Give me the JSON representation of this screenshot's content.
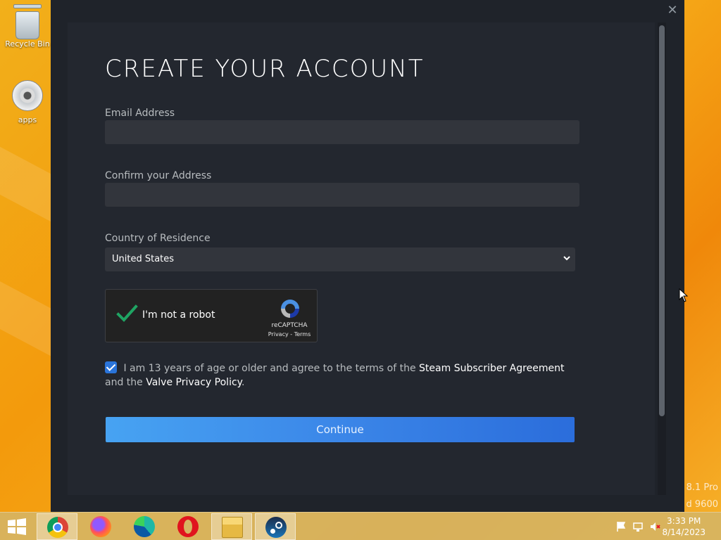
{
  "desktop": {
    "icons": [
      {
        "label": "Recycle Bin",
        "icon": "recycle-bin-icon"
      },
      {
        "label": "apps",
        "icon": "disc-icon"
      }
    ],
    "watermark": {
      "line1": "8.1 Pro",
      "line2": "d 9600"
    }
  },
  "window": {
    "close_symbol": "✕"
  },
  "form": {
    "title": "CREATE YOUR ACCOUNT",
    "email_label": "Email Address",
    "email_value": "",
    "confirm_label": "Confirm your Address",
    "confirm_value": "",
    "country_label": "Country of Residence",
    "country_selected": "United States",
    "captcha": {
      "label": "I'm not a robot",
      "checked": true,
      "brand": "reCAPTCHA",
      "links": "Privacy - Terms"
    },
    "agreement": {
      "checked": true,
      "text_before": "I am 13 years of age or older and agree to the terms of the",
      "link1": "Steam Subscriber Agreement",
      "text_middle": "and the",
      "link2": "Valve Privacy Policy",
      "text_after": "."
    },
    "continue_label": "Continue"
  },
  "taskbar": {
    "apps": [
      {
        "name": "chrome",
        "icon": "chrome-icon",
        "active": true
      },
      {
        "name": "firefox",
        "icon": "firefox-icon",
        "active": false
      },
      {
        "name": "edge",
        "icon": "edge-icon",
        "active": false
      },
      {
        "name": "opera",
        "icon": "opera-icon",
        "active": false
      },
      {
        "name": "file-explorer",
        "icon": "folder-icon",
        "active": true
      },
      {
        "name": "steam",
        "icon": "steam-icon",
        "active": true
      }
    ],
    "tray": [
      "flag-icon",
      "network-icon",
      "volume-muted-icon"
    ],
    "time": "3:33 PM",
    "date": "8/14/2023"
  },
  "colors": {
    "accent": "#2a74da",
    "button_start": "#47a3f2",
    "button_end": "#2b6ddb",
    "captcha_check": "#1fa463"
  }
}
